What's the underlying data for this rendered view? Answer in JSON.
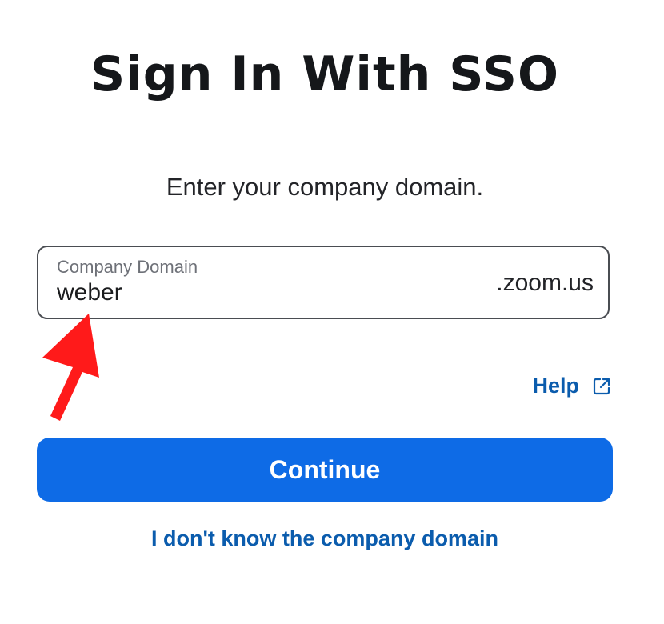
{
  "page": {
    "title": "Sign In With SSO",
    "instruction": "Enter your company domain."
  },
  "domain_field": {
    "label": "Company Domain",
    "value": "weber",
    "suffix": ".zoom.us"
  },
  "help": {
    "label": "Help",
    "icon": "external-link-icon"
  },
  "continue_button": {
    "label": "Continue"
  },
  "unknown_domain_link": {
    "label": "I don't know the company domain"
  },
  "annotation": {
    "icon": "red-arrow-annotation",
    "color": "#ff1a1a"
  },
  "colors": {
    "accent": "#0e6be6",
    "link": "#0b5cad"
  }
}
